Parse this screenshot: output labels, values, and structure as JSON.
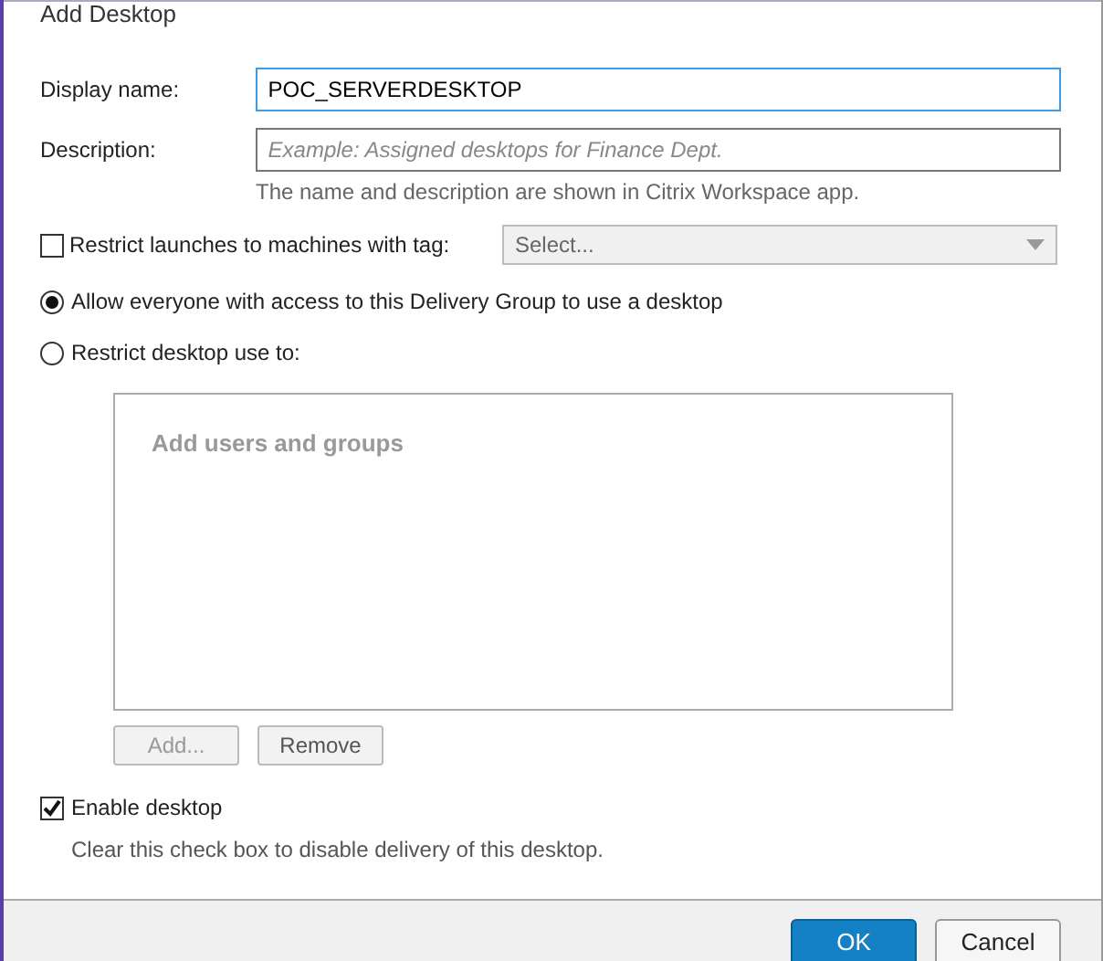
{
  "window": {
    "title": "Add Desktop"
  },
  "display_name": {
    "label": "Display name:",
    "value": "POC_SERVERDESKTOP",
    "focused": true
  },
  "description": {
    "label": "Description:",
    "placeholder": "Example: Assigned desktops for Finance Dept."
  },
  "name_hint": "The name and description are shown in Citrix Workspace app.",
  "tag_restriction": {
    "label": "Restrict launches to machines with tag:",
    "checked": false,
    "select": {
      "placeholder": "Select...",
      "disabled": true
    }
  },
  "access_options": [
    {
      "label": "Allow everyone with access to this Delivery Group to use a desktop",
      "selected": true
    },
    {
      "label": "Restrict desktop use to:",
      "selected": false
    }
  ],
  "users_box": {
    "placeholder": "Add users and groups",
    "buttons": [
      {
        "label": "Add...",
        "disabled": true
      },
      {
        "label": "Remove",
        "disabled": false
      }
    ]
  },
  "enable_desktop": {
    "label": "Enable desktop",
    "checked": true,
    "hint": "Clear this check box to disable delivery of this desktop."
  },
  "footer_buttons": [
    {
      "label": "OK",
      "primary": true
    },
    {
      "label": "Cancel",
      "primary": false
    }
  ]
}
